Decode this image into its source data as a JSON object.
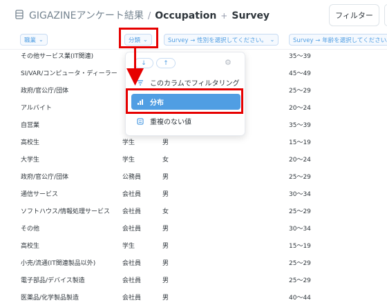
{
  "header": {
    "breadcrumb": "GIGAZINEアンケート結果",
    "separator": "/",
    "page_title": "Occupation",
    "plus_sign": "+",
    "subtitle": "Survey",
    "filter_label": "フィルター"
  },
  "columns": [
    {
      "label": "職業",
      "icon": "chevron-down-icon"
    },
    {
      "label": "分類",
      "icon": "chevron-down-icon"
    },
    {
      "label": "Survey → 性別を選択してください。",
      "icon": "chevron-down-icon"
    },
    {
      "label": "Survey → 年齢を選択してください。",
      "icon": "chevron-down-icon"
    }
  ],
  "rows": [
    [
      "その他サービス業(IT関連)",
      "",
      "",
      "35～39"
    ],
    [
      "SI/VAR/コンピュータ・ディーラー",
      "",
      "",
      "45～49"
    ],
    [
      "政府/官公庁/団体",
      "",
      "",
      "25～29"
    ],
    [
      "アルバイト",
      "",
      "",
      "20～24"
    ],
    [
      "自営業",
      "",
      "",
      "35～39"
    ],
    [
      "高校生",
      "学生",
      "男",
      "15～19"
    ],
    [
      "大学生",
      "学生",
      "女",
      "20～24"
    ],
    [
      "政府/官公庁/団体",
      "公務員",
      "男",
      "25～29"
    ],
    [
      "通信サービス",
      "会社員",
      "男",
      "30～34"
    ],
    [
      "ソフトハウス/情報処理サービス",
      "会社員",
      "女",
      "25～29"
    ],
    [
      "その他",
      "会社員",
      "男",
      "30～34"
    ],
    [
      "高校生",
      "学生",
      "男",
      "15～19"
    ],
    [
      "小売/流通(IT関連製品以外)",
      "会社員",
      "男",
      "25～29"
    ],
    [
      "電子部品/デバイス製造",
      "会社員",
      "男",
      "25～29"
    ],
    [
      "医薬品/化学製品製造",
      "会社員",
      "男",
      "40～44"
    ]
  ],
  "popup": {
    "sort_desc": "↓",
    "sort_asc": "↑",
    "settings_icon": "gear-icon",
    "items": [
      {
        "label": "このカラムでフィルタリング",
        "icon": "filter-icon"
      },
      {
        "label": "分布",
        "icon": "bar-chart-icon"
      },
      {
        "label": "重複のない値",
        "icon": "list-icon"
      }
    ]
  },
  "colors": {
    "accent": "#509ee3",
    "highlight": "#e60000",
    "text": "#2e353b"
  }
}
